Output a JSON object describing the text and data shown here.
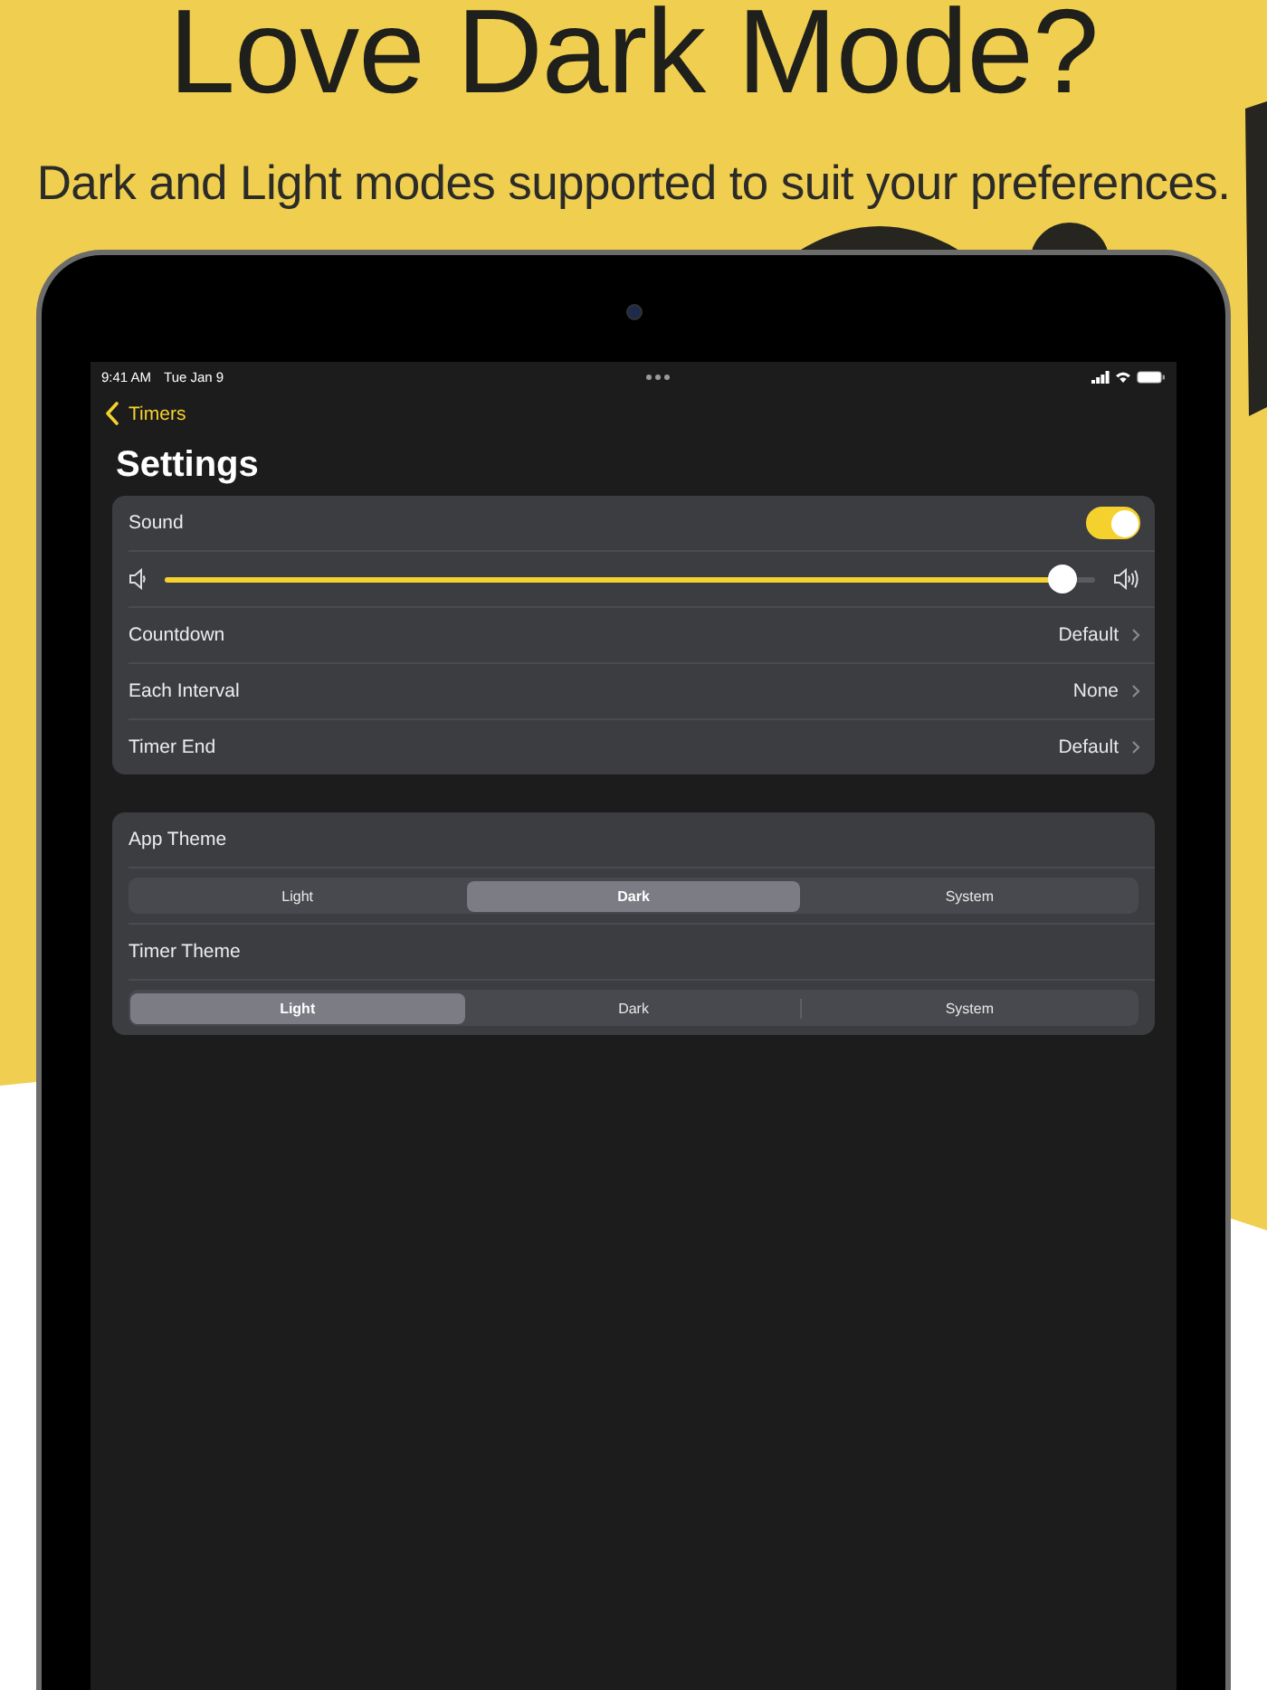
{
  "headline": "Love Dark Mode?",
  "subtitle": "Dark and Light modes supported to suit your preferences.",
  "screen": {
    "status_bar": {
      "time": "9:41 AM",
      "date": "Tue Jan 9"
    },
    "back": "Timers",
    "title": "Settings",
    "sound": {
      "label": "Sound",
      "on": true
    },
    "volume": {
      "level": 0.98
    },
    "rows": [
      {
        "label": "Countdown",
        "value": "Default"
      },
      {
        "label": "Each Interval",
        "value": "None"
      },
      {
        "label": "Timer End",
        "value": "Default"
      }
    ],
    "themes": [
      {
        "label": "App Theme",
        "options": [
          {
            "label": "Light",
            "selected": false
          },
          {
            "label": "Dark",
            "selected": true
          },
          {
            "label": "System",
            "selected": false
          }
        ]
      },
      {
        "label": "Timer Theme",
        "options": [
          {
            "label": "Light",
            "selected": true
          },
          {
            "label": "Dark",
            "selected": false
          },
          {
            "label": "System",
            "selected": false
          }
        ]
      }
    ]
  }
}
